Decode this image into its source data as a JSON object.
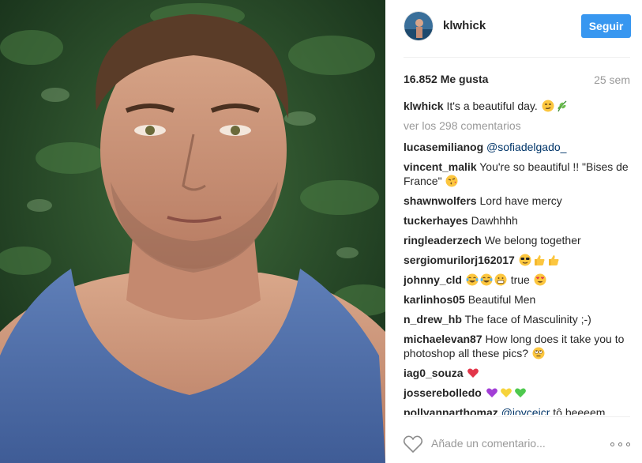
{
  "post": {
    "username": "klwhick",
    "follow_label": "Seguir",
    "likes": "16.852 Me gusta",
    "time": "25 sem",
    "caption_user": "klwhick",
    "caption_text": "It's a beautiful day.",
    "view_comments": "ver los 298 comentarios"
  },
  "comments": [
    {
      "user": "lucasemilianog",
      "text": "",
      "mention": "@sofiadelgado_"
    },
    {
      "user": "vincent_malik",
      "text": "You're so beautiful !! \"Bises de France\""
    },
    {
      "user": "shawnwolfers",
      "text": "Lord have mercy"
    },
    {
      "user": "tuckerhayes",
      "text": "Dawhhhh"
    },
    {
      "user": "ringleaderzech",
      "text": "We belong together"
    },
    {
      "user": "sergiomurilorj162017",
      "text": ""
    },
    {
      "user": "johnny_cld",
      "text": "true"
    },
    {
      "user": "karlinhos05",
      "text": "Beautiful Men"
    },
    {
      "user": "n_drew_hb",
      "text": "The face of Masculinity ;-)"
    },
    {
      "user": "michaelevan87",
      "text": "How long does it take you to photoshop all these pics?"
    },
    {
      "user": "iag0_souza",
      "text": ""
    },
    {
      "user": "josserebolledo",
      "text": ""
    },
    {
      "user": "pollyannarthomaz",
      "text": "tô beeeem",
      "mention": "@joyceicr"
    }
  ],
  "footer": {
    "placeholder": "Añade un comentario..."
  },
  "icons": {
    "heart": "heart-outline-icon",
    "more": "more-options-icon"
  },
  "colors": {
    "accent": "#3897f0",
    "mention": "#003569",
    "muted": "#999999"
  }
}
